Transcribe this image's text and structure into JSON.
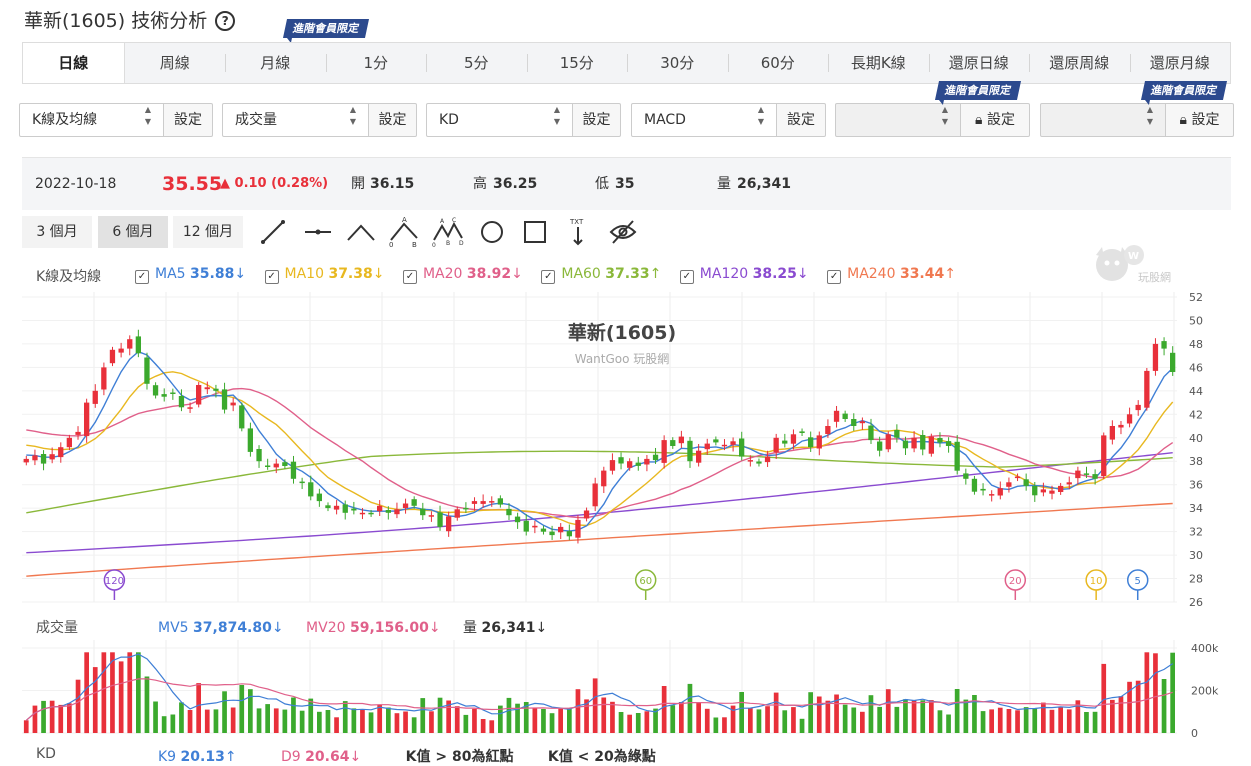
{
  "header": {
    "title": "華新(1605) 技術分析",
    "help_icon": "?"
  },
  "vip_label": "進階會員限定",
  "tabs": [
    "日線",
    "周線",
    "月線",
    "1分",
    "5分",
    "15分",
    "30分",
    "60分",
    "長期K線",
    "還原日線",
    "還原周線",
    "還原月線"
  ],
  "active_tab": 0,
  "indicator_selects": [
    {
      "value": "K線及均線",
      "button": "設定"
    },
    {
      "value": "成交量",
      "button": "設定"
    },
    {
      "value": "KD",
      "button": "設定"
    },
    {
      "value": "MACD",
      "button": "設定"
    },
    {
      "value": "",
      "button": "設定",
      "locked": true
    },
    {
      "value": "",
      "button": "設定",
      "locked": true
    }
  ],
  "quote": {
    "date": "2022-10-18",
    "price": "35.55",
    "change": "▲ 0.10 (0.28%)",
    "open_label": "開",
    "open": "36.15",
    "high_label": "高",
    "high": "36.25",
    "low_label": "低",
    "low": "35",
    "vol_label": "量",
    "vol": "26,341"
  },
  "ranges": [
    "3 個月",
    "6 個月",
    "12 個月"
  ],
  "active_range": 1,
  "tools": [
    "trendline-icon",
    "horizontal-line-icon",
    "angle-icon",
    "pattern-abc-icon",
    "pattern-abcd-icon",
    "circle-icon",
    "rectangle-icon",
    "text-icon",
    "hide-icon"
  ],
  "logo_text": "玩股網",
  "main_legend": {
    "label": "K線及均線",
    "items": [
      {
        "name": "MA5",
        "value": "35.88",
        "arrow": "↓",
        "color": "#3f7fd6"
      },
      {
        "name": "MA10",
        "value": "37.38",
        "arrow": "↓",
        "color": "#e8b820"
      },
      {
        "name": "MA20",
        "value": "38.92",
        "arrow": "↓",
        "color": "#e0608a"
      },
      {
        "name": "MA60",
        "value": "37.33",
        "arrow": "↑",
        "color": "#8ab83a"
      },
      {
        "name": "MA120",
        "value": "38.25",
        "arrow": "↓",
        "color": "#8a4bd0"
      },
      {
        "name": "MA240",
        "value": "33.44",
        "arrow": "↑",
        "color": "#f07850"
      }
    ]
  },
  "chart_title": "華新(1605)",
  "watermark": "WantGoo 玩股網",
  "price_axis": [
    "52",
    "50",
    "48",
    "46",
    "44",
    "42",
    "40",
    "38",
    "36",
    "34",
    "32",
    "30",
    "28",
    "26"
  ],
  "ma_markers": [
    {
      "label": "120",
      "color": "#8a4bd0"
    },
    {
      "label": "60",
      "color": "#8ab83a"
    },
    {
      "label": "20",
      "color": "#e0608a"
    },
    {
      "label": "10",
      "color": "#e8b820"
    },
    {
      "label": "5",
      "color": "#3f7fd6"
    }
  ],
  "volume_legend": {
    "label": "成交量",
    "mv5_name": "MV5",
    "mv5": "37,874.80",
    "mv5_arrow": "↓",
    "mv20_name": "MV20",
    "mv20": "59,156.00",
    "mv20_arrow": "↓",
    "vol_name": "量",
    "vol": "26,341",
    "vol_arrow": "↓"
  },
  "volume_axis": [
    "400k",
    "200k",
    "0"
  ],
  "kd_legend": {
    "label": "KD",
    "k_name": "K9",
    "k": "20.13",
    "k_arrow": "↑",
    "d_name": "D9",
    "d": "20.64",
    "d_arrow": "↓",
    "note1": "K值 > 80為紅點",
    "note2": "K值 < 20為綠點"
  },
  "colors": {
    "up": "#e8303a",
    "down": "#3ba92d",
    "tab_active": "#ffffff",
    "vip": "#2c4a8e",
    "ma5": "#3f7fd6",
    "ma10": "#e8b820",
    "ma20": "#e0608a",
    "ma60": "#8ab83a",
    "ma120": "#8a4bd0",
    "ma240": "#f07850"
  },
  "chart_data": {
    "type": "candlestick",
    "y_range": [
      26,
      52
    ],
    "close": [
      38.2,
      38.5,
      37.8,
      38.6,
      39.2,
      40,
      40.5,
      43,
      44,
      46,
      47.5,
      47.6,
      48.4,
      47.2,
      44.6,
      43.6,
      43.5,
      43.8,
      42.6,
      42.6,
      44.5,
      44.3,
      44,
      42.4,
      43,
      40.8,
      38.8,
      38,
      37.6,
      37.8,
      37.6,
      36.5,
      36.2,
      35,
      34.6,
      34,
      34.2,
      33.6,
      33.8,
      33.6,
      33.5,
      34.2,
      33.6,
      33.9,
      34.4,
      34.2,
      33.4,
      33.4,
      32.4,
      33.3,
      33.9,
      34,
      34.6,
      34.6,
      34.6,
      34.3,
      33.4,
      32.8,
      32,
      32.5,
      32,
      31.7,
      32.4,
      31.6,
      33,
      33.8,
      36.1,
      37.2,
      38.1,
      37.8,
      38,
      37.6,
      38.2,
      38.1,
      39.8,
      39.3,
      40.1,
      38,
      38.9,
      39.5,
      39.6,
      39.4,
      39.7,
      38.4,
      38.1,
      37.8,
      38.4,
      40,
      39.5,
      40.3,
      40.4,
      39.2,
      40.2,
      41,
      42.3,
      41.6,
      41,
      41.4,
      39.8,
      38.9,
      40.3,
      40,
      39.1,
      40,
      39,
      40.1,
      39.6,
      39.3,
      37.2,
      36.5,
      35.4,
      35.5,
      35.2,
      35.7,
      36.2,
      36.7,
      35.9,
      35.1,
      35.6,
      35.5,
      35.9,
      36.2,
      37.2,
      36.9,
      36.5,
      40.2,
      41,
      41.1,
      42,
      42.8,
      45.7,
      48,
      47.6,
      45.6
    ],
    "volume_max": 400000,
    "ma_labels": [
      "MA5",
      "MA10",
      "MA20",
      "MA60",
      "MA120",
      "MA240"
    ]
  }
}
